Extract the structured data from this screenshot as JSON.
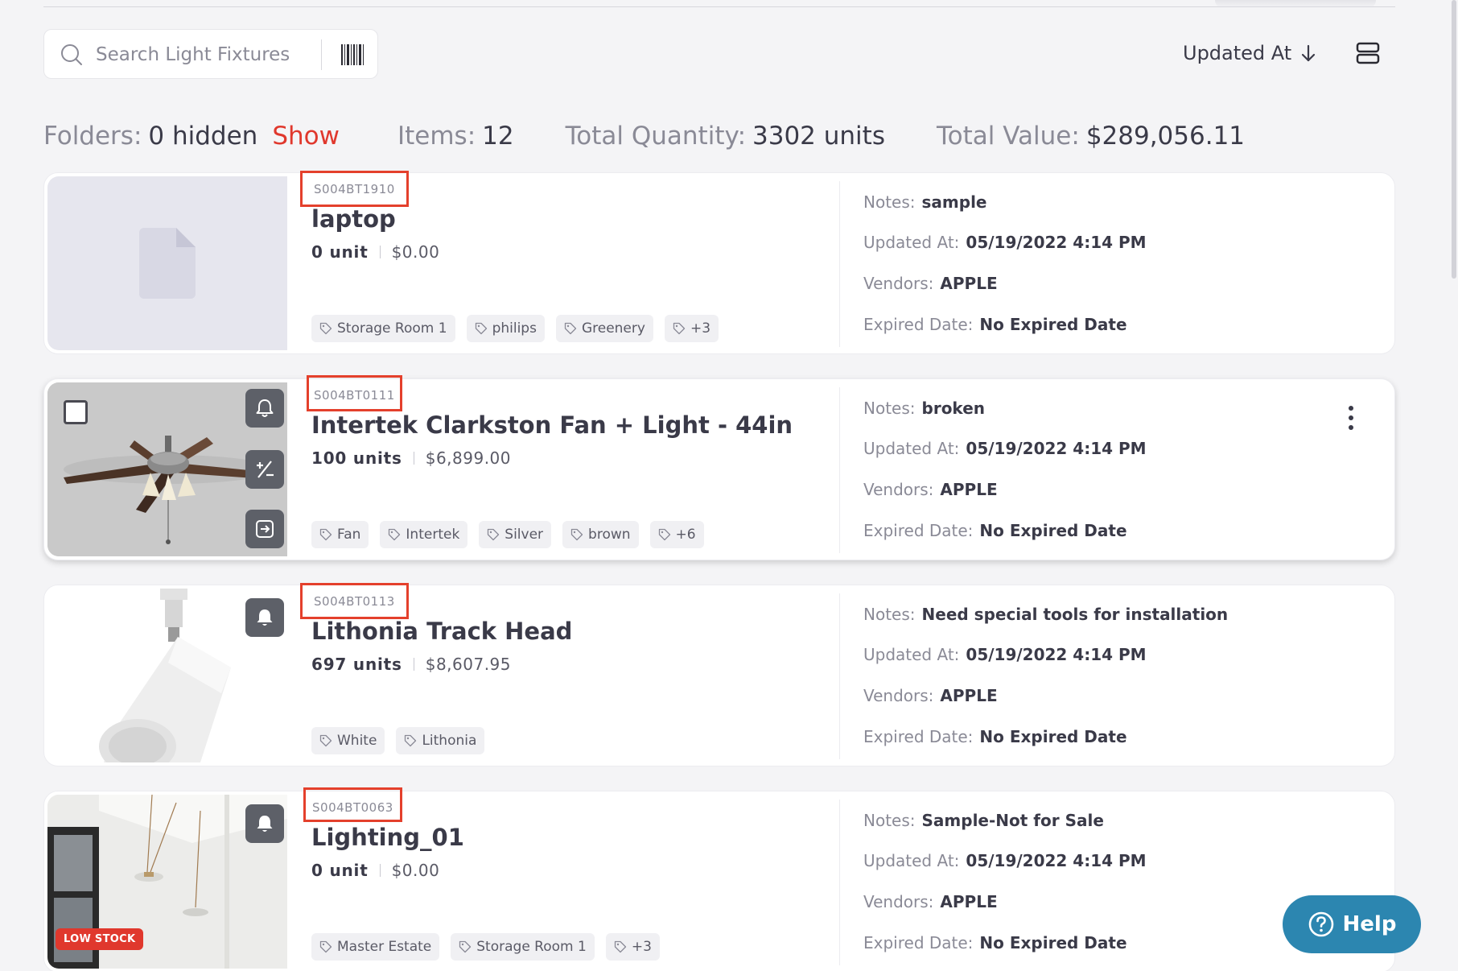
{
  "search": {
    "placeholder": "Search Light Fixtures"
  },
  "sort": {
    "label": "Updated At"
  },
  "summary": {
    "folders_label": "Folders:",
    "folders_value": "0 hidden",
    "show_label": "Show",
    "items_label": "Items:",
    "items_value": "12",
    "quantity_label": "Total Quantity:",
    "quantity_value": "3302 units",
    "value_label": "Total Value:",
    "value_value": "$289,056.11"
  },
  "meta_labels": {
    "notes": "Notes:",
    "updated": "Updated At:",
    "vendors": "Vendors:",
    "expired": "Expired Date:"
  },
  "items": [
    {
      "sku": "S004BT1910",
      "name": "laptop",
      "qty": "0 unit",
      "price": "$0.00",
      "tags": [
        "Storage Room 1",
        "philips",
        "Greenery",
        "+3"
      ],
      "notes": "sample",
      "updated": "05/19/2022 4:14 PM",
      "vendors": "APPLE",
      "expired": "No Expired Date"
    },
    {
      "sku": "S004BT0111",
      "name": "Intertek Clarkston Fan + Light - 44in",
      "qty": "100 units",
      "price": "$6,899.00",
      "tags": [
        "Fan",
        "Intertek",
        "Silver",
        "brown",
        "+6"
      ],
      "notes": "broken",
      "updated": "05/19/2022 4:14 PM",
      "vendors": "APPLE",
      "expired": "No Expired Date"
    },
    {
      "sku": "S004BT0113",
      "name": "Lithonia Track Head",
      "qty": "697 units",
      "price": "$8,607.95",
      "tags": [
        "White",
        "Lithonia"
      ],
      "notes": "Need special tools for installation",
      "updated": "05/19/2022 4:14 PM",
      "vendors": "APPLE",
      "expired": "No Expired Date"
    },
    {
      "sku": "S004BT0063",
      "name": "Lighting_01",
      "qty": "0 unit",
      "price": "$0.00",
      "tags": [
        "Master Estate",
        "Storage Room 1",
        "+3"
      ],
      "notes": "Sample-Not for Sale",
      "updated": "05/19/2022 4:14 PM",
      "vendors": "APPLE",
      "expired": "No Expired Date",
      "badge": "LOW STOCK"
    }
  ],
  "help": {
    "label": "Help"
  },
  "colors": {
    "accent_red": "#e0382d",
    "help_blue": "#2c86b0",
    "highlight_box": "#e4402c"
  }
}
